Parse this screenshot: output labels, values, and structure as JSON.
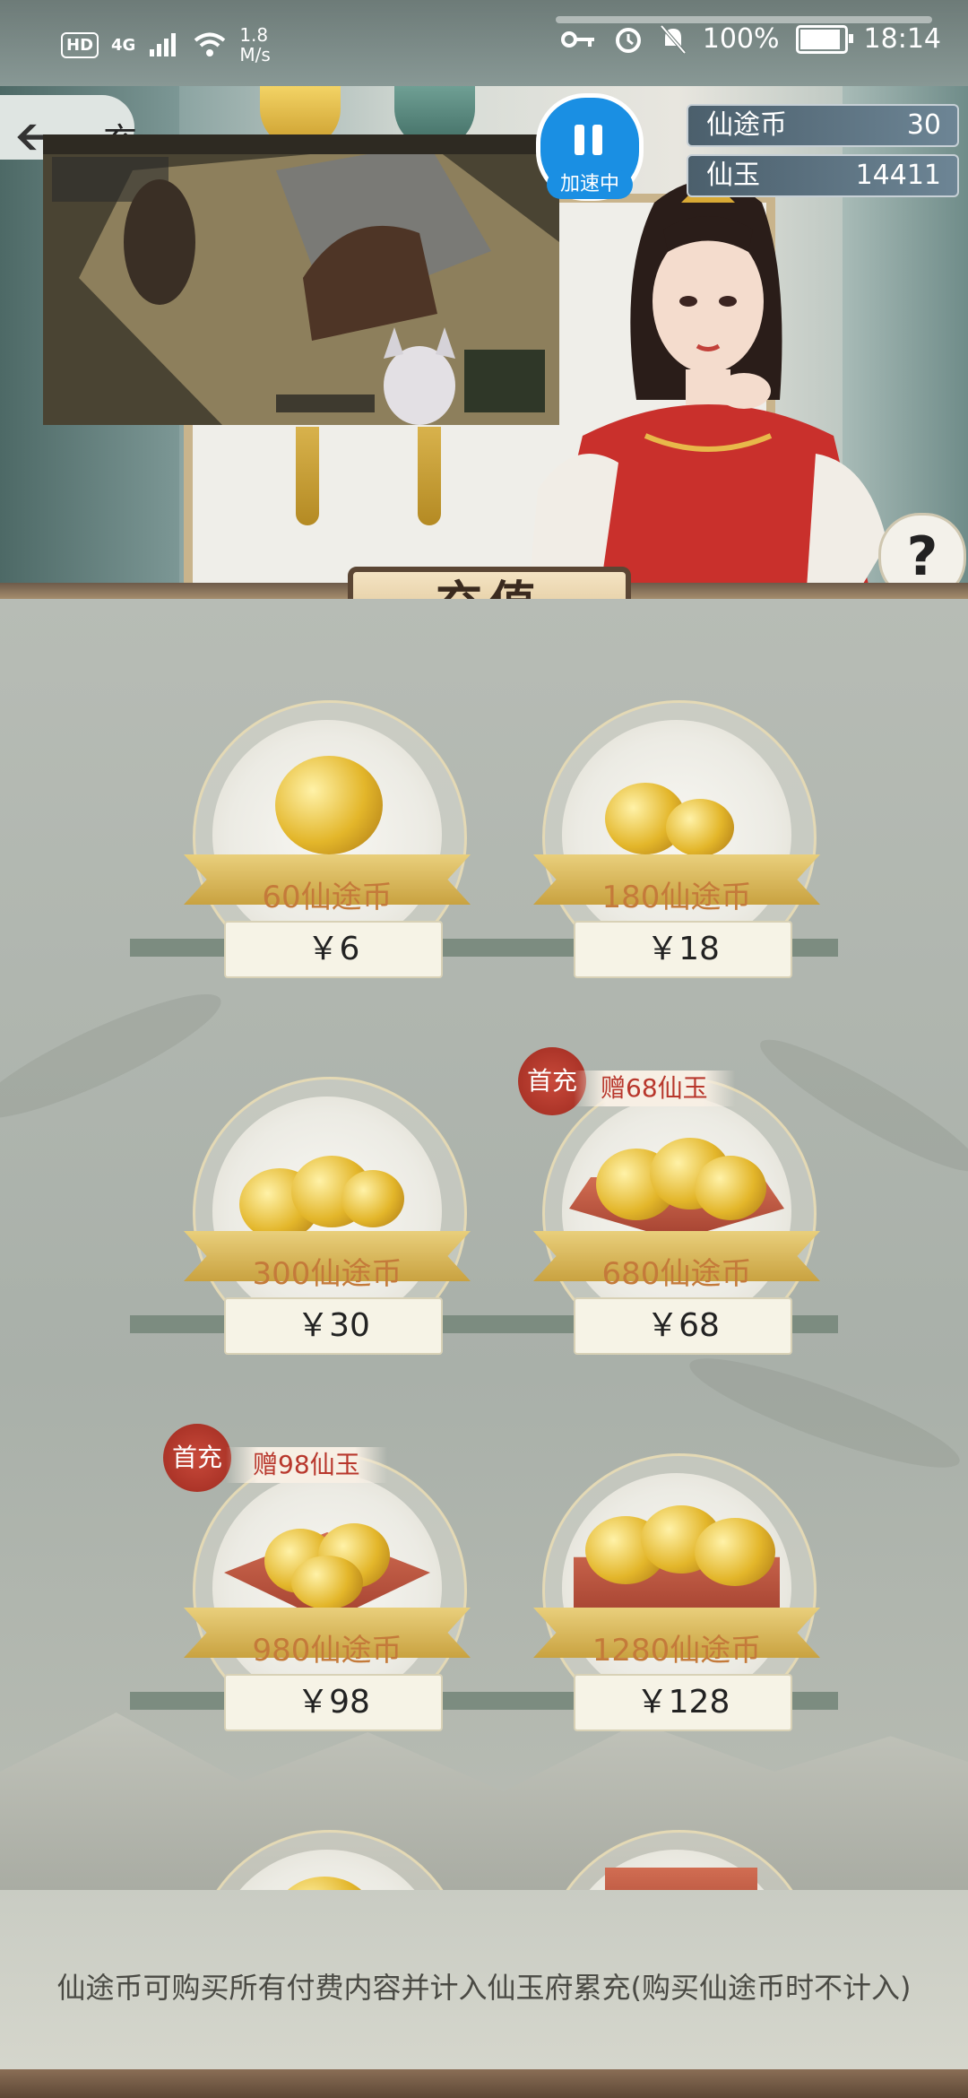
{
  "status_bar": {
    "hd": "HD",
    "network": "4G",
    "speed_value": "1.8",
    "speed_unit": "M/s",
    "battery": "100%",
    "time": "18:14"
  },
  "header": {
    "page_title": "充值",
    "accelerate_label": "加速中",
    "resources": [
      {
        "name": "仙途币",
        "value": "30"
      },
      {
        "name": "仙玉",
        "value": "14411"
      }
    ],
    "help": "?"
  },
  "section_title": "充值",
  "products": [
    {
      "amount": "60仙途币",
      "price": "￥6",
      "first_recharge": "",
      "bonus": ""
    },
    {
      "amount": "180仙途币",
      "price": "￥18",
      "first_recharge": "",
      "bonus": ""
    },
    {
      "amount": "300仙途币",
      "price": "￥30",
      "first_recharge": "",
      "bonus": ""
    },
    {
      "amount": "680仙途币",
      "price": "￥68",
      "first_recharge": "首充",
      "bonus": "赠68仙玉"
    },
    {
      "amount": "980仙途币",
      "price": "￥98",
      "first_recharge": "首充",
      "bonus": "赠98仙玉"
    },
    {
      "amount": "1280仙途币",
      "price": "￥128",
      "first_recharge": "",
      "bonus": ""
    }
  ],
  "footer_note": "仙途币可购买所有付费内容并计入仙玉府累充(购买仙途币时不计入)",
  "colors": {
    "accent_blue": "#1a8fe3",
    "price_text": "#222222",
    "amount_text": "#c47a3a",
    "badge_red": "#b8372c"
  }
}
